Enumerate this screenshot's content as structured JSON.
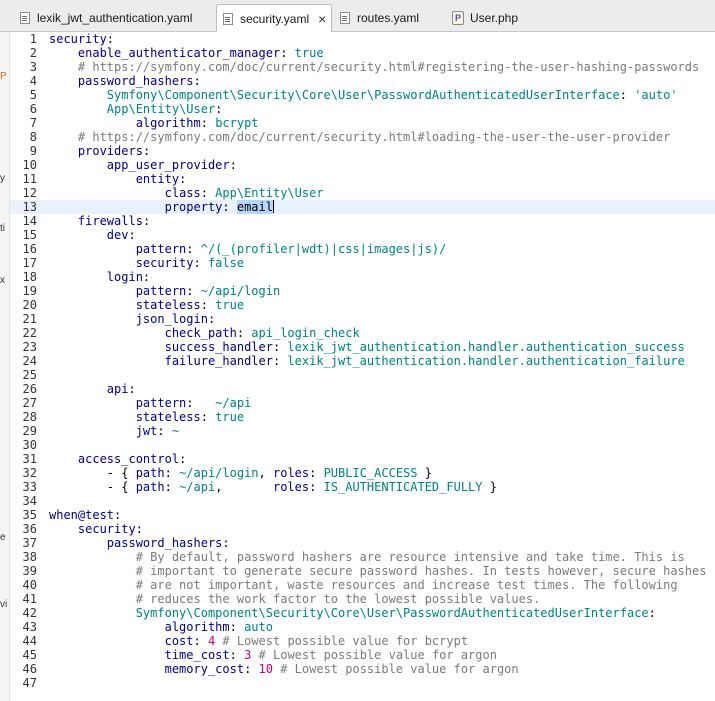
{
  "tabs": [
    {
      "label": "lexik_jwt_authentication.yaml",
      "icon": "yaml-file-icon",
      "active": false
    },
    {
      "label": "security.yaml",
      "icon": "yaml-file-icon",
      "active": true,
      "close": "×"
    },
    {
      "label": "routes.yaml",
      "icon": "yaml-file-icon",
      "active": false
    },
    {
      "label": "User.php",
      "icon": "php-file-icon",
      "icon_text": "P",
      "active": false
    }
  ],
  "left_panel_fragments": [
    "P",
    "y",
    "ti",
    "x",
    "e",
    "vi"
  ],
  "editor": {
    "current_line": 13,
    "lines": [
      [
        [
          "k",
          "security"
        ],
        [
          "p",
          ":"
        ]
      ],
      [
        [
          "p",
          "    "
        ],
        [
          "k",
          "enable_authenticator_manager"
        ],
        [
          "p",
          ": "
        ],
        [
          "s",
          "true"
        ]
      ],
      [
        [
          "p",
          "    "
        ],
        [
          "c",
          "# https://symfony.com/doc/current/security.html#registering-the-user-hashing-passwords"
        ]
      ],
      [
        [
          "p",
          "    "
        ],
        [
          "k",
          "password_hashers"
        ],
        [
          "p",
          ":"
        ]
      ],
      [
        [
          "p",
          "        "
        ],
        [
          "s",
          "Symfony\\Component\\Security\\Core\\User\\PasswordAuthenticatedUserInterface"
        ],
        [
          "p",
          ": "
        ],
        [
          "s",
          "'auto'"
        ]
      ],
      [
        [
          "p",
          "        "
        ],
        [
          "s",
          "App\\Entity\\User"
        ],
        [
          "p",
          ":"
        ]
      ],
      [
        [
          "p",
          "            "
        ],
        [
          "k",
          "algorithm"
        ],
        [
          "p",
          ": "
        ],
        [
          "s",
          "bcrypt"
        ]
      ],
      [
        [
          "p",
          "    "
        ],
        [
          "c",
          "# https://symfony.com/doc/current/security.html#loading-the-user-the-user-provider"
        ]
      ],
      [
        [
          "p",
          "    "
        ],
        [
          "k",
          "providers"
        ],
        [
          "p",
          ":"
        ]
      ],
      [
        [
          "p",
          "        "
        ],
        [
          "k",
          "app_user_provider"
        ],
        [
          "p",
          ":"
        ]
      ],
      [
        [
          "p",
          "            "
        ],
        [
          "k",
          "entity"
        ],
        [
          "p",
          ":"
        ]
      ],
      [
        [
          "p",
          "                "
        ],
        [
          "k",
          "class"
        ],
        [
          "p",
          ": "
        ],
        [
          "s",
          "App\\Entity\\User"
        ]
      ],
      [
        [
          "p",
          "                "
        ],
        [
          "k",
          "property"
        ],
        [
          "p",
          ": "
        ],
        [
          "sel",
          "email"
        ],
        [
          "caret",
          ""
        ]
      ],
      [
        [
          "p",
          "    "
        ],
        [
          "k",
          "firewalls"
        ],
        [
          "p",
          ":"
        ]
      ],
      [
        [
          "p",
          "        "
        ],
        [
          "k",
          "dev"
        ],
        [
          "p",
          ":"
        ]
      ],
      [
        [
          "p",
          "            "
        ],
        [
          "k",
          "pattern"
        ],
        [
          "p",
          ": "
        ],
        [
          "s",
          "^/(_(profiler|wdt)|css|images|js)/"
        ]
      ],
      [
        [
          "p",
          "            "
        ],
        [
          "k",
          "security"
        ],
        [
          "p",
          ": "
        ],
        [
          "s",
          "false"
        ]
      ],
      [
        [
          "p",
          "        "
        ],
        [
          "k",
          "login"
        ],
        [
          "p",
          ":"
        ]
      ],
      [
        [
          "p",
          "            "
        ],
        [
          "k",
          "pattern"
        ],
        [
          "p",
          ": "
        ],
        [
          "s",
          "~/api/login"
        ]
      ],
      [
        [
          "p",
          "            "
        ],
        [
          "k",
          "stateless"
        ],
        [
          "p",
          ": "
        ],
        [
          "s",
          "true"
        ]
      ],
      [
        [
          "p",
          "            "
        ],
        [
          "k",
          "json_login"
        ],
        [
          "p",
          ":"
        ]
      ],
      [
        [
          "p",
          "                "
        ],
        [
          "k",
          "check_path"
        ],
        [
          "p",
          ": "
        ],
        [
          "s",
          "api_login_check"
        ]
      ],
      [
        [
          "p",
          "                "
        ],
        [
          "k",
          "success_handler"
        ],
        [
          "p",
          ": "
        ],
        [
          "s",
          "lexik_jwt_authentication.handler.authentication_success"
        ]
      ],
      [
        [
          "p",
          "                "
        ],
        [
          "k",
          "failure_handler"
        ],
        [
          "p",
          ": "
        ],
        [
          "s",
          "lexik_jwt_authentication.handler.authentication_failure"
        ]
      ],
      [],
      [
        [
          "p",
          "        "
        ],
        [
          "k",
          "api"
        ],
        [
          "p",
          ":"
        ]
      ],
      [
        [
          "p",
          "            "
        ],
        [
          "k",
          "pattern"
        ],
        [
          "p",
          ":   "
        ],
        [
          "s",
          "~/api"
        ]
      ],
      [
        [
          "p",
          "            "
        ],
        [
          "k",
          "stateless"
        ],
        [
          "p",
          ": "
        ],
        [
          "s",
          "true"
        ]
      ],
      [
        [
          "p",
          "            "
        ],
        [
          "k",
          "jwt"
        ],
        [
          "p",
          ": "
        ],
        [
          "s",
          "~"
        ]
      ],
      [],
      [
        [
          "p",
          "    "
        ],
        [
          "k",
          "access_control"
        ],
        [
          "p",
          ":"
        ]
      ],
      [
        [
          "p",
          "        - { "
        ],
        [
          "k",
          "path"
        ],
        [
          "p",
          ": "
        ],
        [
          "s",
          "~/api/login"
        ],
        [
          "p",
          ", "
        ],
        [
          "k",
          "roles"
        ],
        [
          "p",
          ": "
        ],
        [
          "s",
          "PUBLIC_ACCESS"
        ],
        [
          "p",
          " }"
        ]
      ],
      [
        [
          "p",
          "        - { "
        ],
        [
          "k",
          "path"
        ],
        [
          "p",
          ": "
        ],
        [
          "s",
          "~/api"
        ],
        [
          "p",
          ",       "
        ],
        [
          "k",
          "roles"
        ],
        [
          "p",
          ": "
        ],
        [
          "s",
          "IS_AUTHENTICATED_FULLY"
        ],
        [
          "p",
          " }"
        ]
      ],
      [],
      [
        [
          "k",
          "when@test"
        ],
        [
          "p",
          ":"
        ]
      ],
      [
        [
          "p",
          "    "
        ],
        [
          "k",
          "security"
        ],
        [
          "p",
          ":"
        ]
      ],
      [
        [
          "p",
          "        "
        ],
        [
          "k",
          "password_hashers"
        ],
        [
          "p",
          ":"
        ]
      ],
      [
        [
          "p",
          "            "
        ],
        [
          "c",
          "# By default, password hashers are resource intensive and take time. This is"
        ]
      ],
      [
        [
          "p",
          "            "
        ],
        [
          "c",
          "# important to generate secure password hashes. In tests however, secure hashes"
        ]
      ],
      [
        [
          "p",
          "            "
        ],
        [
          "c",
          "# are not important, waste resources and increase test times. The following"
        ]
      ],
      [
        [
          "p",
          "            "
        ],
        [
          "c",
          "# reduces the work factor to the lowest possible values."
        ]
      ],
      [
        [
          "p",
          "            "
        ],
        [
          "s",
          "Symfony\\Component\\Security\\Core\\User\\PasswordAuthenticatedUserInterface"
        ],
        [
          "p",
          ":"
        ]
      ],
      [
        [
          "p",
          "                "
        ],
        [
          "k",
          "algorithm"
        ],
        [
          "p",
          ": "
        ],
        [
          "s",
          "auto"
        ]
      ],
      [
        [
          "p",
          "                "
        ],
        [
          "k",
          "cost"
        ],
        [
          "p",
          ": "
        ],
        [
          "n",
          "4"
        ],
        [
          "p",
          " "
        ],
        [
          "c",
          "# Lowest possible value for bcrypt"
        ]
      ],
      [
        [
          "p",
          "                "
        ],
        [
          "k",
          "time_cost"
        ],
        [
          "p",
          ": "
        ],
        [
          "n",
          "3"
        ],
        [
          "p",
          " "
        ],
        [
          "c",
          "# Lowest possible value for argon"
        ]
      ],
      [
        [
          "p",
          "                "
        ],
        [
          "k",
          "memory_cost"
        ],
        [
          "p",
          ": "
        ],
        [
          "n",
          "10"
        ],
        [
          "p",
          " "
        ],
        [
          "c",
          "# Lowest possible value for argon"
        ]
      ],
      []
    ]
  }
}
